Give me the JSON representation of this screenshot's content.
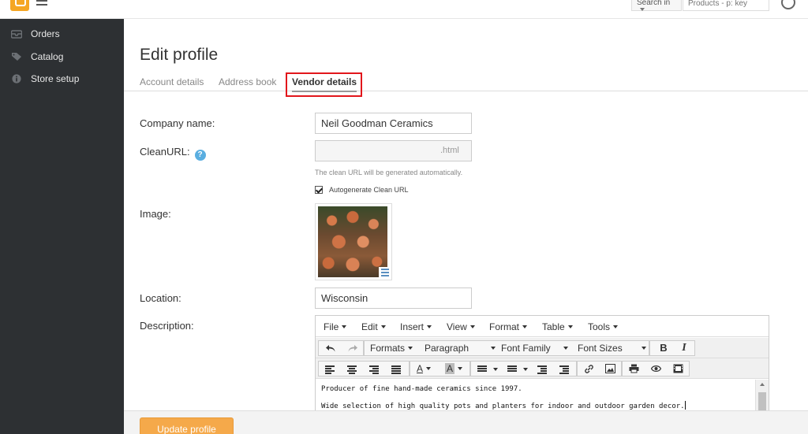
{
  "topbar": {
    "logo_icon": "cart-logo-icon",
    "menu_icon": "hamburger-icon",
    "search_in_label": "Search in",
    "search_placeholder": "Products - p: key",
    "user_icon": "user-avatar-icon"
  },
  "sidebar": {
    "items": [
      {
        "label": "Orders",
        "icon": "orders-icon"
      },
      {
        "label": "Catalog",
        "icon": "tag-icon"
      },
      {
        "label": "Store setup",
        "icon": "info-icon"
      }
    ]
  },
  "page": {
    "title": "Edit profile",
    "tabs": [
      {
        "label": "Account details",
        "active": false
      },
      {
        "label": "Address book",
        "active": false
      },
      {
        "label": "Vendor details",
        "active": true
      }
    ],
    "highlight_color": "#e2161b"
  },
  "form": {
    "company_label": "Company name:",
    "company_value": "Neil Goodman Ceramics",
    "cleanurl_label": "CleanURL:",
    "cleanurl_value": "",
    "cleanurl_suffix": ".html",
    "cleanurl_hint": "The clean URL will be generated automatically.",
    "autogenerate_label": "Autogenerate Clean URL",
    "autogenerate_checked": true,
    "image_label": "Image:",
    "location_label": "Location:",
    "location_value": "Wisconsin",
    "description_label": "Description:"
  },
  "editor": {
    "menus": [
      "File",
      "Edit",
      "Insert",
      "View",
      "Format",
      "Table",
      "Tools"
    ],
    "formats_label": "Formats",
    "paragraph_label": "Paragraph",
    "font_family_label": "Font Family",
    "font_sizes_label": "Font Sizes",
    "bold_label": "B",
    "italic_label": "I",
    "text_color_label": "A",
    "bg_color_label": "A",
    "content": [
      "Producer of fine hand-made ceramics since 1997.",
      "Wide selection of high quality pots and planters for indoor and outdoor garden decor."
    ]
  },
  "footer": {
    "update_label": "Update profile",
    "accent_color": "#f5a94a"
  }
}
